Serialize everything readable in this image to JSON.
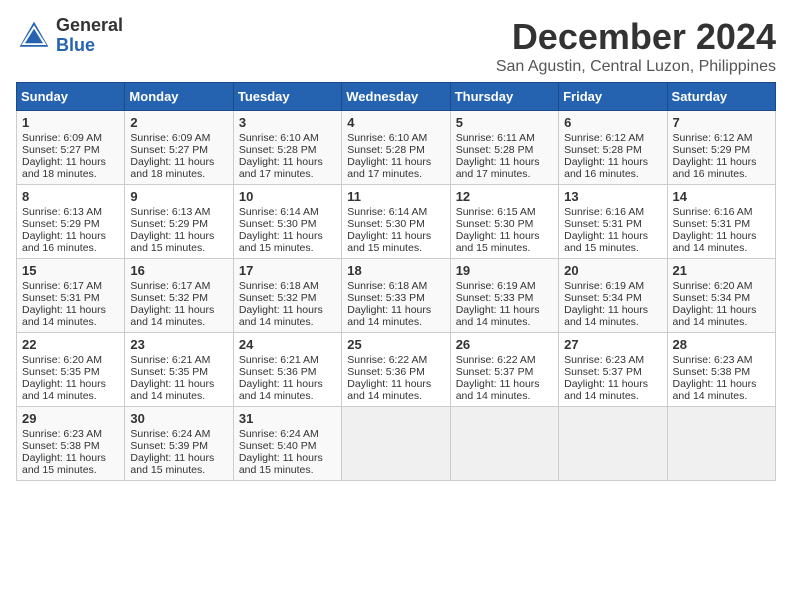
{
  "header": {
    "logo_general": "General",
    "logo_blue": "Blue",
    "month_title": "December 2024",
    "location": "San Agustin, Central Luzon, Philippines"
  },
  "days_of_week": [
    "Sunday",
    "Monday",
    "Tuesday",
    "Wednesday",
    "Thursday",
    "Friday",
    "Saturday"
  ],
  "weeks": [
    [
      {
        "day": 1,
        "sunrise": "6:09 AM",
        "sunset": "5:27 PM",
        "daylight": "11 hours and 18 minutes."
      },
      {
        "day": 2,
        "sunrise": "6:09 AM",
        "sunset": "5:27 PM",
        "daylight": "11 hours and 18 minutes."
      },
      {
        "day": 3,
        "sunrise": "6:10 AM",
        "sunset": "5:28 PM",
        "daylight": "11 hours and 17 minutes."
      },
      {
        "day": 4,
        "sunrise": "6:10 AM",
        "sunset": "5:28 PM",
        "daylight": "11 hours and 17 minutes."
      },
      {
        "day": 5,
        "sunrise": "6:11 AM",
        "sunset": "5:28 PM",
        "daylight": "11 hours and 17 minutes."
      },
      {
        "day": 6,
        "sunrise": "6:12 AM",
        "sunset": "5:28 PM",
        "daylight": "11 hours and 16 minutes."
      },
      {
        "day": 7,
        "sunrise": "6:12 AM",
        "sunset": "5:29 PM",
        "daylight": "11 hours and 16 minutes."
      }
    ],
    [
      {
        "day": 8,
        "sunrise": "6:13 AM",
        "sunset": "5:29 PM",
        "daylight": "11 hours and 16 minutes."
      },
      {
        "day": 9,
        "sunrise": "6:13 AM",
        "sunset": "5:29 PM",
        "daylight": "11 hours and 15 minutes."
      },
      {
        "day": 10,
        "sunrise": "6:14 AM",
        "sunset": "5:30 PM",
        "daylight": "11 hours and 15 minutes."
      },
      {
        "day": 11,
        "sunrise": "6:14 AM",
        "sunset": "5:30 PM",
        "daylight": "11 hours and 15 minutes."
      },
      {
        "day": 12,
        "sunrise": "6:15 AM",
        "sunset": "5:30 PM",
        "daylight": "11 hours and 15 minutes."
      },
      {
        "day": 13,
        "sunrise": "6:16 AM",
        "sunset": "5:31 PM",
        "daylight": "11 hours and 15 minutes."
      },
      {
        "day": 14,
        "sunrise": "6:16 AM",
        "sunset": "5:31 PM",
        "daylight": "11 hours and 14 minutes."
      }
    ],
    [
      {
        "day": 15,
        "sunrise": "6:17 AM",
        "sunset": "5:31 PM",
        "daylight": "11 hours and 14 minutes."
      },
      {
        "day": 16,
        "sunrise": "6:17 AM",
        "sunset": "5:32 PM",
        "daylight": "11 hours and 14 minutes."
      },
      {
        "day": 17,
        "sunrise": "6:18 AM",
        "sunset": "5:32 PM",
        "daylight": "11 hours and 14 minutes."
      },
      {
        "day": 18,
        "sunrise": "6:18 AM",
        "sunset": "5:33 PM",
        "daylight": "11 hours and 14 minutes."
      },
      {
        "day": 19,
        "sunrise": "6:19 AM",
        "sunset": "5:33 PM",
        "daylight": "11 hours and 14 minutes."
      },
      {
        "day": 20,
        "sunrise": "6:19 AM",
        "sunset": "5:34 PM",
        "daylight": "11 hours and 14 minutes."
      },
      {
        "day": 21,
        "sunrise": "6:20 AM",
        "sunset": "5:34 PM",
        "daylight": "11 hours and 14 minutes."
      }
    ],
    [
      {
        "day": 22,
        "sunrise": "6:20 AM",
        "sunset": "5:35 PM",
        "daylight": "11 hours and 14 minutes."
      },
      {
        "day": 23,
        "sunrise": "6:21 AM",
        "sunset": "5:35 PM",
        "daylight": "11 hours and 14 minutes."
      },
      {
        "day": 24,
        "sunrise": "6:21 AM",
        "sunset": "5:36 PM",
        "daylight": "11 hours and 14 minutes."
      },
      {
        "day": 25,
        "sunrise": "6:22 AM",
        "sunset": "5:36 PM",
        "daylight": "11 hours and 14 minutes."
      },
      {
        "day": 26,
        "sunrise": "6:22 AM",
        "sunset": "5:37 PM",
        "daylight": "11 hours and 14 minutes."
      },
      {
        "day": 27,
        "sunrise": "6:23 AM",
        "sunset": "5:37 PM",
        "daylight": "11 hours and 14 minutes."
      },
      {
        "day": 28,
        "sunrise": "6:23 AM",
        "sunset": "5:38 PM",
        "daylight": "11 hours and 14 minutes."
      }
    ],
    [
      {
        "day": 29,
        "sunrise": "6:23 AM",
        "sunset": "5:38 PM",
        "daylight": "11 hours and 15 minutes."
      },
      {
        "day": 30,
        "sunrise": "6:24 AM",
        "sunset": "5:39 PM",
        "daylight": "11 hours and 15 minutes."
      },
      {
        "day": 31,
        "sunrise": "6:24 AM",
        "sunset": "5:40 PM",
        "daylight": "11 hours and 15 minutes."
      },
      null,
      null,
      null,
      null
    ]
  ]
}
